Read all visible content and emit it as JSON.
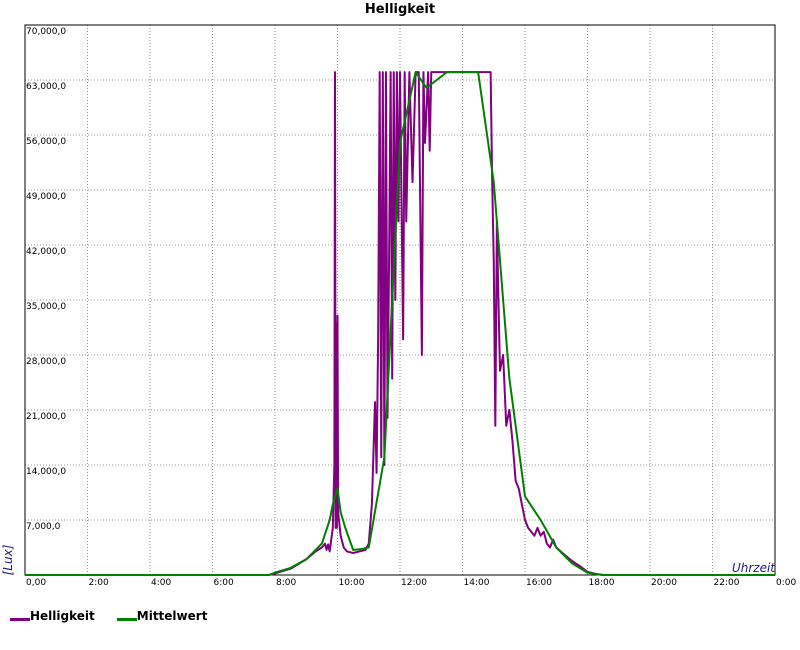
{
  "chart_data": {
    "type": "line",
    "title": "Helligkeit",
    "xlabel": "Uhrzeit",
    "ylabel": "[Lux]",
    "xlim": [
      0,
      24
    ],
    "ylim": [
      0,
      70000
    ],
    "x_ticks": [
      "0,00",
      "2:00",
      "4:00",
      "6:00",
      "8:00",
      "10:00",
      "12:00",
      "14:00",
      "16:00",
      "18:00",
      "20:00",
      "22:00",
      "0:00"
    ],
    "y_ticks": [
      "7,000,0",
      "14,000,0",
      "21,000,0",
      "28,000,0",
      "35,000,0",
      "42,000,0",
      "49,000,0",
      "56,000,0",
      "63,000,0",
      "70,000,0"
    ],
    "grid": true,
    "legend_position": "bottom-left",
    "series": [
      {
        "name": "Helligkeit",
        "color": "#800080",
        "points": [
          [
            0,
            0
          ],
          [
            7.8,
            0
          ],
          [
            8.0,
            200
          ],
          [
            8.5,
            800
          ],
          [
            9.0,
            2000
          ],
          [
            9.3,
            3000
          ],
          [
            9.5,
            3500
          ],
          [
            9.6,
            4000
          ],
          [
            9.65,
            3200
          ],
          [
            9.7,
            3900
          ],
          [
            9.75,
            3000
          ],
          [
            9.8,
            4500
          ],
          [
            9.85,
            6000
          ],
          [
            9.9,
            14000
          ],
          [
            9.92,
            64000
          ],
          [
            9.94,
            6000
          ],
          [
            9.96,
            32000
          ],
          [
            9.98,
            6000
          ],
          [
            10.0,
            33000
          ],
          [
            10.02,
            8000
          ],
          [
            10.1,
            5000
          ],
          [
            10.2,
            3500
          ],
          [
            10.3,
            3000
          ],
          [
            10.5,
            2800
          ],
          [
            10.7,
            3000
          ],
          [
            10.9,
            3200
          ],
          [
            11.0,
            4000
          ],
          [
            11.1,
            9000
          ],
          [
            11.2,
            22000
          ],
          [
            11.25,
            13000
          ],
          [
            11.3,
            30000
          ],
          [
            11.35,
            64000
          ],
          [
            11.4,
            15000
          ],
          [
            11.45,
            64000
          ],
          [
            11.5,
            14000
          ],
          [
            11.55,
            64000
          ],
          [
            11.6,
            20000
          ],
          [
            11.65,
            40000
          ],
          [
            11.7,
            64000
          ],
          [
            11.75,
            25000
          ],
          [
            11.8,
            64000
          ],
          [
            11.85,
            35000
          ],
          [
            11.9,
            64000
          ],
          [
            11.95,
            45000
          ],
          [
            12.0,
            64000
          ],
          [
            12.1,
            30000
          ],
          [
            12.15,
            64000
          ],
          [
            12.2,
            45000
          ],
          [
            12.3,
            64000
          ],
          [
            12.4,
            50000
          ],
          [
            12.5,
            64000
          ],
          [
            12.6,
            64000
          ],
          [
            12.7,
            28000
          ],
          [
            12.75,
            64000
          ],
          [
            12.8,
            55000
          ],
          [
            12.9,
            64000
          ],
          [
            12.95,
            54000
          ],
          [
            13.0,
            64000
          ],
          [
            14.9,
            64000
          ],
          [
            14.95,
            50000
          ],
          [
            15.0,
            40000
          ],
          [
            15.05,
            19000
          ],
          [
            15.1,
            45000
          ],
          [
            15.15,
            35000
          ],
          [
            15.2,
            26000
          ],
          [
            15.3,
            28000
          ],
          [
            15.4,
            19000
          ],
          [
            15.5,
            21000
          ],
          [
            15.6,
            17000
          ],
          [
            15.7,
            12000
          ],
          [
            15.8,
            11000
          ],
          [
            15.9,
            9000
          ],
          [
            16.0,
            7000
          ],
          [
            16.1,
            6000
          ],
          [
            16.2,
            5500
          ],
          [
            16.3,
            5000
          ],
          [
            16.4,
            6000
          ],
          [
            16.5,
            5000
          ],
          [
            16.6,
            5500
          ],
          [
            16.7,
            4000
          ],
          [
            16.8,
            3500
          ],
          [
            16.9,
            4500
          ],
          [
            17.0,
            3500
          ],
          [
            17.2,
            2800
          ],
          [
            17.5,
            1800
          ],
          [
            17.8,
            1000
          ],
          [
            18.0,
            400
          ],
          [
            18.3,
            100
          ],
          [
            18.5,
            0
          ],
          [
            24,
            0
          ]
        ]
      },
      {
        "name": "Mittelwert",
        "color": "#008000",
        "points": [
          [
            0,
            0
          ],
          [
            7.8,
            0
          ],
          [
            8.0,
            300
          ],
          [
            8.5,
            900
          ],
          [
            9.0,
            2000
          ],
          [
            9.5,
            4000
          ],
          [
            9.75,
            7000
          ],
          [
            9.85,
            9000
          ],
          [
            10.0,
            11000
          ],
          [
            10.1,
            8000
          ],
          [
            10.25,
            6000
          ],
          [
            10.5,
            3200
          ],
          [
            10.75,
            3300
          ],
          [
            11.0,
            3500
          ],
          [
            11.5,
            15000
          ],
          [
            12.0,
            55000
          ],
          [
            12.5,
            64000
          ],
          [
            12.85,
            62000
          ],
          [
            13.5,
            64000
          ],
          [
            14.5,
            64000
          ],
          [
            15.0,
            50000
          ],
          [
            15.5,
            25000
          ],
          [
            16.0,
            10000
          ],
          [
            16.5,
            7000
          ],
          [
            17.0,
            3500
          ],
          [
            17.5,
            1500
          ],
          [
            18.0,
            300
          ],
          [
            18.5,
            0
          ],
          [
            24,
            0
          ]
        ]
      }
    ]
  }
}
